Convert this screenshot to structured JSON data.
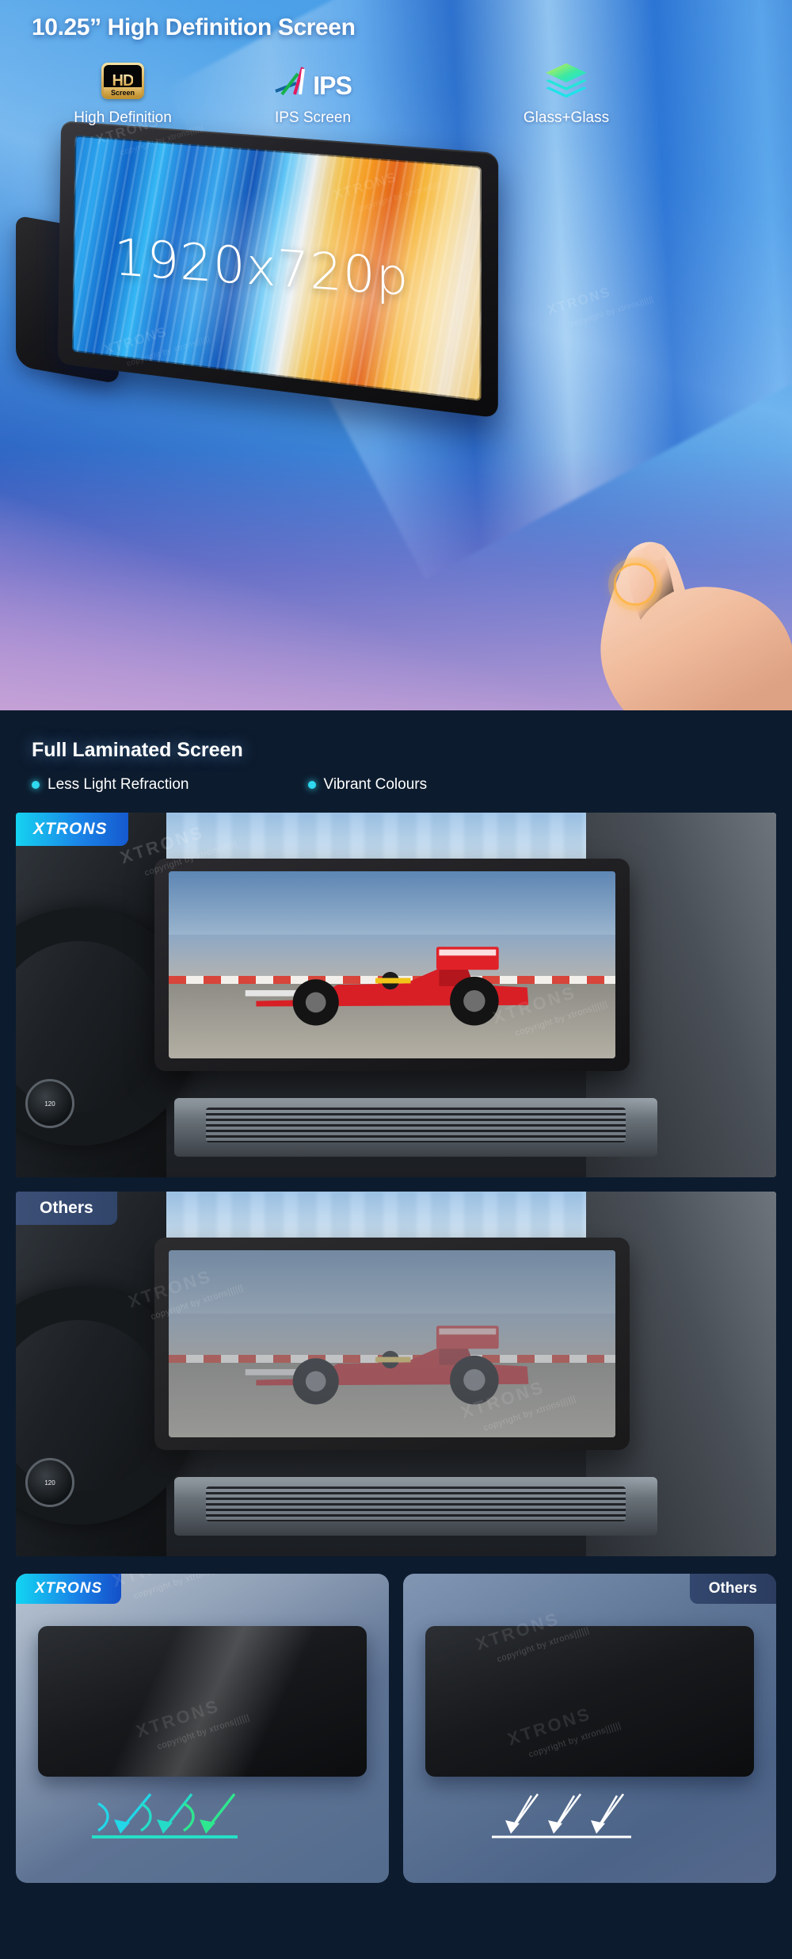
{
  "hero": {
    "title": "10.25” High Definition Screen",
    "features": [
      {
        "icon": "hd-badge-icon",
        "badge_main": "HD",
        "badge_sub": "Screen",
        "label": "High Definition"
      },
      {
        "icon": "ips-logo-icon",
        "logo_text": "IPS",
        "label": "IPS Screen"
      },
      {
        "icon": "glass-layers-icon",
        "label": "Glass+Glass"
      }
    ],
    "screen_resolution": "1920x720p",
    "watermarks": [
      "XTRONS",
      "copyright by xtrons||||||"
    ]
  },
  "laminated": {
    "title": "Full Laminated Screen",
    "bullets": [
      {
        "label": "Less Light Refraction"
      },
      {
        "label": "Vibrant Colours"
      }
    ],
    "comparison_photos": [
      {
        "badge": "XTRONS",
        "badge_style": "brand",
        "caption": ""
      },
      {
        "badge": "Others",
        "badge_style": "others",
        "caption": ""
      }
    ],
    "watermarks": [
      "XTRONS",
      "copyright by xtrons||||||"
    ]
  },
  "comparison_cards": [
    {
      "badge": "XTRONS",
      "badge_style": "brand",
      "ray_color": "#2fe3d8",
      "watermark": "XTRONS",
      "watermark_sub": "copyright by xtrons||||||"
    },
    {
      "badge": "Others",
      "badge_style": "others",
      "ray_color": "#ffffff",
      "watermark": "XTRONS",
      "watermark_sub": "copyright by xtrons||||||"
    }
  ],
  "colors": {
    "brand_cyan": "#15d2f0",
    "brand_blue": "#1559cf",
    "bullet_dot": "#2fd8ef",
    "hero_blue": "#3f9ae6",
    "dark_bg": "#0d1b2e",
    "others_badge": "#3c4f76",
    "hd_gold": "#e0b964",
    "ray_good": "#2fe3d8",
    "ray_bad": "#ffffff"
  }
}
